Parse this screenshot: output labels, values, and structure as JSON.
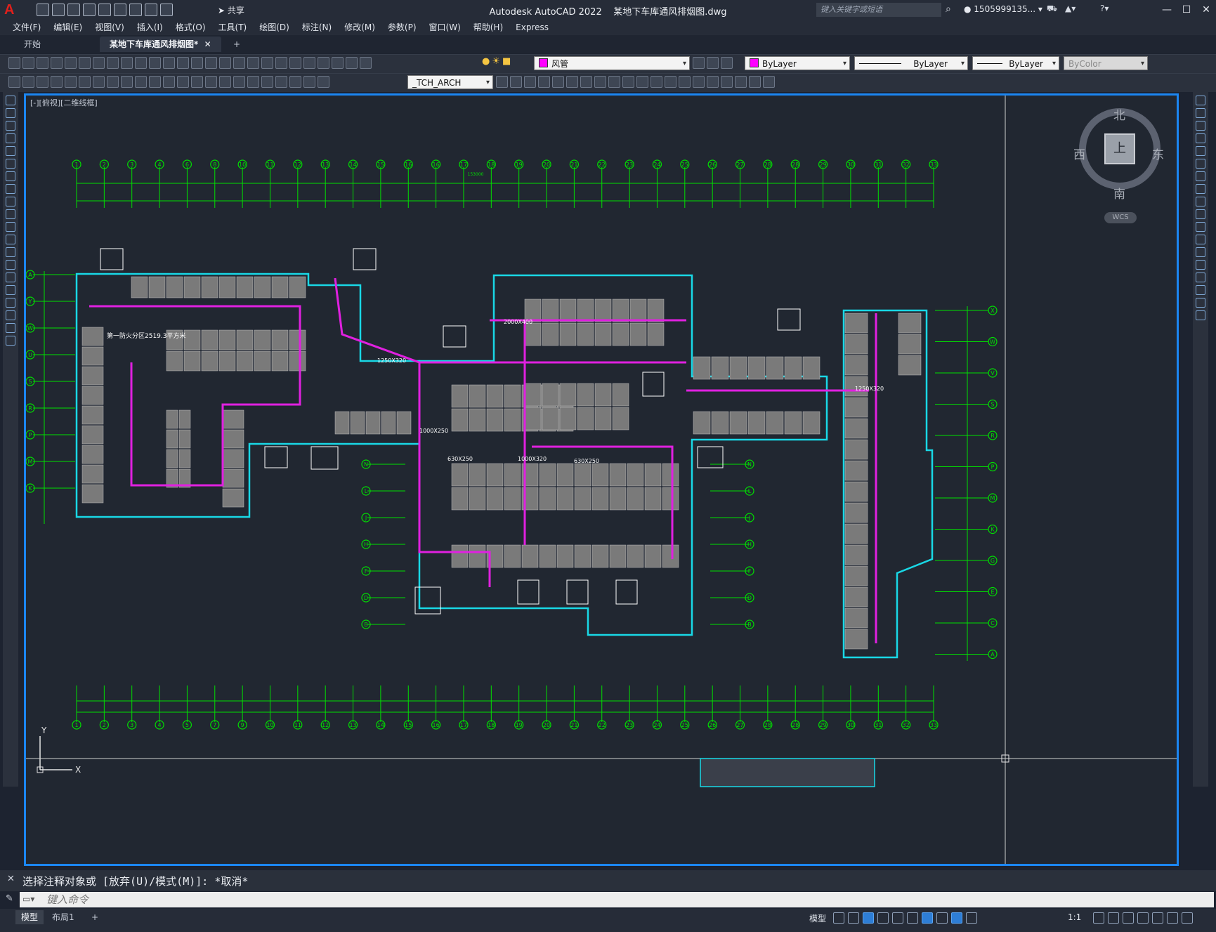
{
  "app": {
    "logo_letter": "A",
    "title": "Autodesk AutoCAD 2022",
    "filename": "某地下车库通风排烟图.dwg",
    "share_label": "共享",
    "search_placeholder": "键入关键字或短语",
    "user_id": "1505999135...",
    "minimize": "—",
    "maximize": "☐",
    "close": "✕"
  },
  "menu": [
    "文件(F)",
    "编辑(E)",
    "视图(V)",
    "插入(I)",
    "格式(O)",
    "工具(T)",
    "绘图(D)",
    "标注(N)",
    "修改(M)",
    "参数(P)",
    "窗口(W)",
    "帮助(H)",
    "Express"
  ],
  "tabs": {
    "start": "开始",
    "document": "某地下车库通风排烟图*",
    "add": "+"
  },
  "toolbar": {
    "layer_name": "风管",
    "layer_color": "#ff00ff",
    "color_value": "ByLayer",
    "linetype_value": "ByLayer",
    "lineweight_value": "ByLayer",
    "plotstyle_value": "ByColor",
    "text_style": "_TCH_ARCH"
  },
  "viewport": {
    "label": "[-][俯视][二维线框]",
    "compass": {
      "north": "北",
      "south": "南",
      "east": "东",
      "west": "西",
      "top": "上"
    },
    "wcs": "WCS"
  },
  "drawing": {
    "top_axis_labels": [
      "1",
      "2",
      "3",
      "4",
      "6",
      "8",
      "10",
      "11",
      "12",
      "13",
      "14",
      "15",
      "16",
      "16",
      "17",
      "18",
      "19",
      "20",
      "21",
      "22",
      "23",
      "24",
      "25",
      "26",
      "27",
      "28",
      "28",
      "29",
      "30",
      "31",
      "32",
      "33"
    ],
    "bottom_axis_labels": [
      "1",
      "2",
      "3",
      "4",
      "5",
      "7",
      "9",
      "10",
      "11",
      "12",
      "13",
      "14",
      "15",
      "16",
      "17",
      "18",
      "19",
      "20",
      "21",
      "22",
      "23",
      "24",
      "25",
      "26",
      "27",
      "28",
      "28",
      "29",
      "30",
      "31",
      "32",
      "33"
    ],
    "left_axis_labels": [
      "A",
      "Y",
      "W",
      "U",
      "S",
      "R",
      "P",
      "M",
      "K"
    ],
    "middle_axis_labels": [
      "N",
      "L",
      "J",
      "H",
      "F",
      "D",
      "B"
    ],
    "right_axis_labels": [
      "X",
      "W",
      "V",
      "S",
      "R",
      "P",
      "M",
      "K",
      "G",
      "E",
      "C",
      "A"
    ],
    "floor_note": "第一防火分区2519.3平方米",
    "duct_tags": [
      "1250X320",
      "1250X320",
      "1000X250",
      "630X250",
      "1000X320",
      "630X250",
      "2000X400"
    ],
    "grid_total": "153000"
  },
  "command": {
    "history": "选择注释对象或 [放弃(U)/模式(M)]: *取消*",
    "placeholder": "键入命令"
  },
  "status": {
    "model_tab": "模型",
    "layout_tab": "布局1",
    "add": "+",
    "model_label": "模型",
    "scale": "1:1"
  },
  "colors": {
    "canvas": "#212731",
    "grid_green": "#00e000",
    "wall_cyan": "#19d8e6",
    "duct_magenta": "#e020e0",
    "parking_gray": "#7a7a7a",
    "viewport_border": "#1b86f2"
  }
}
